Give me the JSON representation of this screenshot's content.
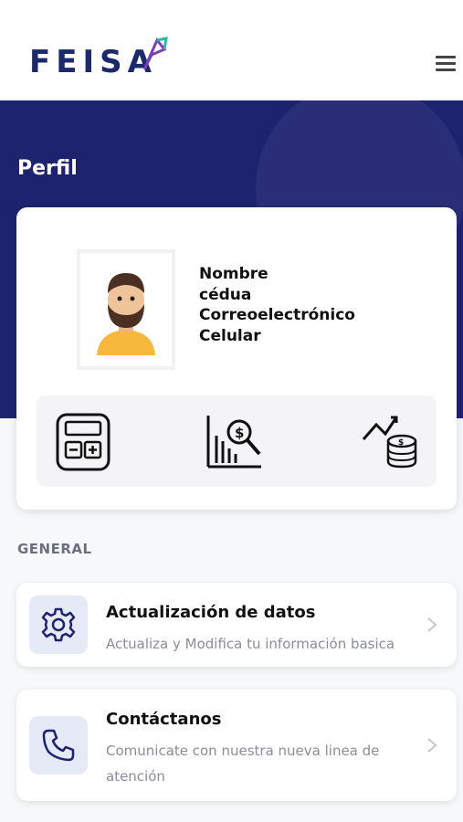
{
  "header": {
    "brand": "FEISA",
    "menu_icon": "hamburger-menu-icon"
  },
  "profile": {
    "title": "Perfil",
    "name": "Nombre",
    "id_label": "cédua",
    "email_label": "Correoelectrónico",
    "phone_label": "Celular"
  },
  "quick_actions": [
    {
      "icon": "calculator-icon"
    },
    {
      "icon": "chart-search-icon"
    },
    {
      "icon": "growth-coins-icon"
    }
  ],
  "general": {
    "section_label": "GENERAL",
    "items": [
      {
        "title": "Actualización de datos",
        "subtitle": "Actualiza y Modifica tu información basica",
        "icon": "gear-icon"
      },
      {
        "title": "Contáctanos",
        "subtitle": "Comunicate con nuestra nueva linea de atención",
        "icon": "phone-icon"
      }
    ]
  },
  "colors": {
    "hero_bg": "#1e2370",
    "brand_text": "#1c2a6b",
    "icon_bg": "#e6e9f6"
  }
}
